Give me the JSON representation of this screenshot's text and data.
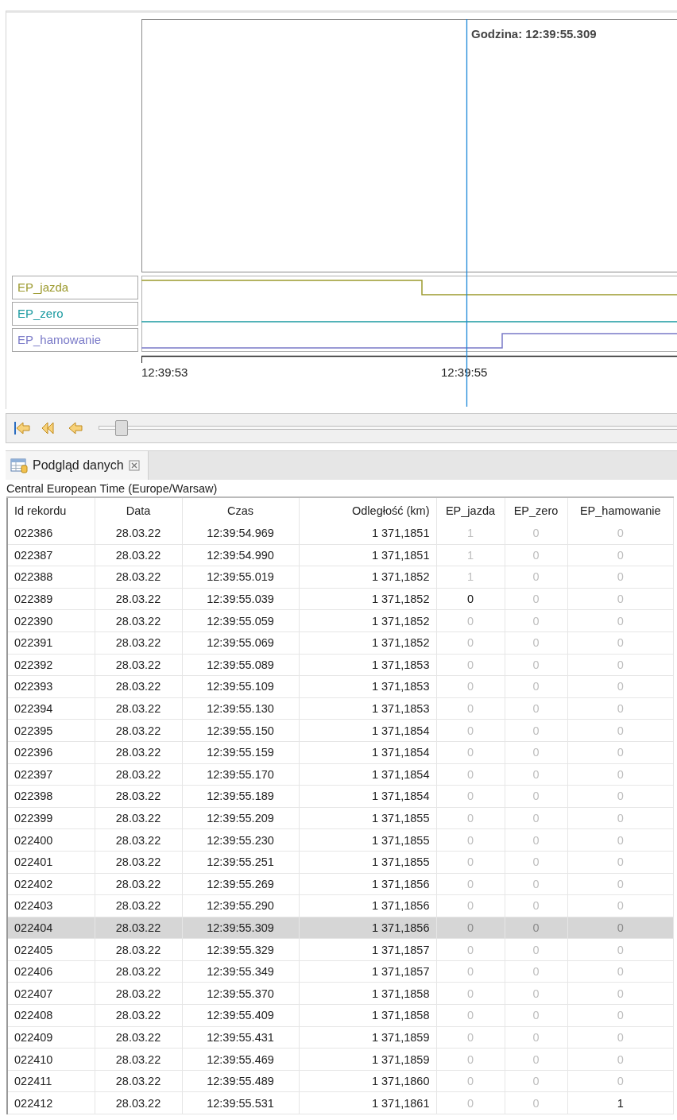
{
  "chart": {
    "cursor_label": "Godzina: 12:39:55.309",
    "signals": [
      {
        "name": "EP_jazda",
        "color": "#9c9a2e"
      },
      {
        "name": "EP_zero",
        "color": "#1a9aa0"
      },
      {
        "name": "EP_hamowanie",
        "color": "#7a7ac8"
      }
    ],
    "ticks": [
      "12:39:53",
      "12:39:55"
    ]
  },
  "player": {
    "slider": {
      "level": 0.04
    }
  },
  "view": {
    "tab_title": "Podgląd danych",
    "timezone": "Central European Time (Europe/Warsaw)"
  },
  "table": {
    "columns": [
      "Id rekordu",
      "Data",
      "Czas",
      "Odległość (km)",
      "EP_jazda",
      "EP_zero",
      "EP_hamowanie"
    ],
    "rows": [
      {
        "cells": [
          "022386",
          "28.03.22",
          "12:39:54.969",
          "1 371,1851"
        ],
        "flags": [
          {
            "value": "1",
            "changed": false
          },
          {
            "value": "0",
            "changed": false
          },
          {
            "value": "0",
            "changed": false
          }
        ],
        "selected": false
      },
      {
        "cells": [
          "022387",
          "28.03.22",
          "12:39:54.990",
          "1 371,1851"
        ],
        "flags": [
          {
            "value": "1",
            "changed": false
          },
          {
            "value": "0",
            "changed": false
          },
          {
            "value": "0",
            "changed": false
          }
        ],
        "selected": false
      },
      {
        "cells": [
          "022388",
          "28.03.22",
          "12:39:55.019",
          "1 371,1852"
        ],
        "flags": [
          {
            "value": "1",
            "changed": false
          },
          {
            "value": "0",
            "changed": false
          },
          {
            "value": "0",
            "changed": false
          }
        ],
        "selected": false
      },
      {
        "cells": [
          "022389",
          "28.03.22",
          "12:39:55.039",
          "1 371,1852"
        ],
        "flags": [
          {
            "value": "0",
            "changed": true
          },
          {
            "value": "0",
            "changed": false
          },
          {
            "value": "0",
            "changed": false
          }
        ],
        "selected": false
      },
      {
        "cells": [
          "022390",
          "28.03.22",
          "12:39:55.059",
          "1 371,1852"
        ],
        "flags": [
          {
            "value": "0",
            "changed": false
          },
          {
            "value": "0",
            "changed": false
          },
          {
            "value": "0",
            "changed": false
          }
        ],
        "selected": false
      },
      {
        "cells": [
          "022391",
          "28.03.22",
          "12:39:55.069",
          "1 371,1852"
        ],
        "flags": [
          {
            "value": "0",
            "changed": false
          },
          {
            "value": "0",
            "changed": false
          },
          {
            "value": "0",
            "changed": false
          }
        ],
        "selected": false
      },
      {
        "cells": [
          "022392",
          "28.03.22",
          "12:39:55.089",
          "1 371,1853"
        ],
        "flags": [
          {
            "value": "0",
            "changed": false
          },
          {
            "value": "0",
            "changed": false
          },
          {
            "value": "0",
            "changed": false
          }
        ],
        "selected": false
      },
      {
        "cells": [
          "022393",
          "28.03.22",
          "12:39:55.109",
          "1 371,1853"
        ],
        "flags": [
          {
            "value": "0",
            "changed": false
          },
          {
            "value": "0",
            "changed": false
          },
          {
            "value": "0",
            "changed": false
          }
        ],
        "selected": false
      },
      {
        "cells": [
          "022394",
          "28.03.22",
          "12:39:55.130",
          "1 371,1853"
        ],
        "flags": [
          {
            "value": "0",
            "changed": false
          },
          {
            "value": "0",
            "changed": false
          },
          {
            "value": "0",
            "changed": false
          }
        ],
        "selected": false
      },
      {
        "cells": [
          "022395",
          "28.03.22",
          "12:39:55.150",
          "1 371,1854"
        ],
        "flags": [
          {
            "value": "0",
            "changed": false
          },
          {
            "value": "0",
            "changed": false
          },
          {
            "value": "0",
            "changed": false
          }
        ],
        "selected": false
      },
      {
        "cells": [
          "022396",
          "28.03.22",
          "12:39:55.159",
          "1 371,1854"
        ],
        "flags": [
          {
            "value": "0",
            "changed": false
          },
          {
            "value": "0",
            "changed": false
          },
          {
            "value": "0",
            "changed": false
          }
        ],
        "selected": false
      },
      {
        "cells": [
          "022397",
          "28.03.22",
          "12:39:55.170",
          "1 371,1854"
        ],
        "flags": [
          {
            "value": "0",
            "changed": false
          },
          {
            "value": "0",
            "changed": false
          },
          {
            "value": "0",
            "changed": false
          }
        ],
        "selected": false
      },
      {
        "cells": [
          "022398",
          "28.03.22",
          "12:39:55.189",
          "1 371,1854"
        ],
        "flags": [
          {
            "value": "0",
            "changed": false
          },
          {
            "value": "0",
            "changed": false
          },
          {
            "value": "0",
            "changed": false
          }
        ],
        "selected": false
      },
      {
        "cells": [
          "022399",
          "28.03.22",
          "12:39:55.209",
          "1 371,1855"
        ],
        "flags": [
          {
            "value": "0",
            "changed": false
          },
          {
            "value": "0",
            "changed": false
          },
          {
            "value": "0",
            "changed": false
          }
        ],
        "selected": false
      },
      {
        "cells": [
          "022400",
          "28.03.22",
          "12:39:55.230",
          "1 371,1855"
        ],
        "flags": [
          {
            "value": "0",
            "changed": false
          },
          {
            "value": "0",
            "changed": false
          },
          {
            "value": "0",
            "changed": false
          }
        ],
        "selected": false
      },
      {
        "cells": [
          "022401",
          "28.03.22",
          "12:39:55.251",
          "1 371,1855"
        ],
        "flags": [
          {
            "value": "0",
            "changed": false
          },
          {
            "value": "0",
            "changed": false
          },
          {
            "value": "0",
            "changed": false
          }
        ],
        "selected": false
      },
      {
        "cells": [
          "022402",
          "28.03.22",
          "12:39:55.269",
          "1 371,1856"
        ],
        "flags": [
          {
            "value": "0",
            "changed": false
          },
          {
            "value": "0",
            "changed": false
          },
          {
            "value": "0",
            "changed": false
          }
        ],
        "selected": false
      },
      {
        "cells": [
          "022403",
          "28.03.22",
          "12:39:55.290",
          "1 371,1856"
        ],
        "flags": [
          {
            "value": "0",
            "changed": false
          },
          {
            "value": "0",
            "changed": false
          },
          {
            "value": "0",
            "changed": false
          }
        ],
        "selected": false
      },
      {
        "cells": [
          "022404",
          "28.03.22",
          "12:39:55.309",
          "1 371,1856"
        ],
        "flags": [
          {
            "value": "0",
            "changed": false
          },
          {
            "value": "0",
            "changed": false
          },
          {
            "value": "0",
            "changed": false
          }
        ],
        "selected": true
      },
      {
        "cells": [
          "022405",
          "28.03.22",
          "12:39:55.329",
          "1 371,1857"
        ],
        "flags": [
          {
            "value": "0",
            "changed": false
          },
          {
            "value": "0",
            "changed": false
          },
          {
            "value": "0",
            "changed": false
          }
        ],
        "selected": false
      },
      {
        "cells": [
          "022406",
          "28.03.22",
          "12:39:55.349",
          "1 371,1857"
        ],
        "flags": [
          {
            "value": "0",
            "changed": false
          },
          {
            "value": "0",
            "changed": false
          },
          {
            "value": "0",
            "changed": false
          }
        ],
        "selected": false
      },
      {
        "cells": [
          "022407",
          "28.03.22",
          "12:39:55.370",
          "1 371,1858"
        ],
        "flags": [
          {
            "value": "0",
            "changed": false
          },
          {
            "value": "0",
            "changed": false
          },
          {
            "value": "0",
            "changed": false
          }
        ],
        "selected": false
      },
      {
        "cells": [
          "022408",
          "28.03.22",
          "12:39:55.409",
          "1 371,1858"
        ],
        "flags": [
          {
            "value": "0",
            "changed": false
          },
          {
            "value": "0",
            "changed": false
          },
          {
            "value": "0",
            "changed": false
          }
        ],
        "selected": false
      },
      {
        "cells": [
          "022409",
          "28.03.22",
          "12:39:55.431",
          "1 371,1859"
        ],
        "flags": [
          {
            "value": "0",
            "changed": false
          },
          {
            "value": "0",
            "changed": false
          },
          {
            "value": "0",
            "changed": false
          }
        ],
        "selected": false
      },
      {
        "cells": [
          "022410",
          "28.03.22",
          "12:39:55.469",
          "1 371,1859"
        ],
        "flags": [
          {
            "value": "0",
            "changed": false
          },
          {
            "value": "0",
            "changed": false
          },
          {
            "value": "0",
            "changed": false
          }
        ],
        "selected": false
      },
      {
        "cells": [
          "022411",
          "28.03.22",
          "12:39:55.489",
          "1 371,1860"
        ],
        "flags": [
          {
            "value": "0",
            "changed": false
          },
          {
            "value": "0",
            "changed": false
          },
          {
            "value": "0",
            "changed": false
          }
        ],
        "selected": false
      },
      {
        "cells": [
          "022412",
          "28.03.22",
          "12:39:55.531",
          "1 371,1861"
        ],
        "flags": [
          {
            "value": "0",
            "changed": false
          },
          {
            "value": "0",
            "changed": false
          },
          {
            "value": "1",
            "changed": true
          }
        ],
        "selected": false
      }
    ]
  }
}
